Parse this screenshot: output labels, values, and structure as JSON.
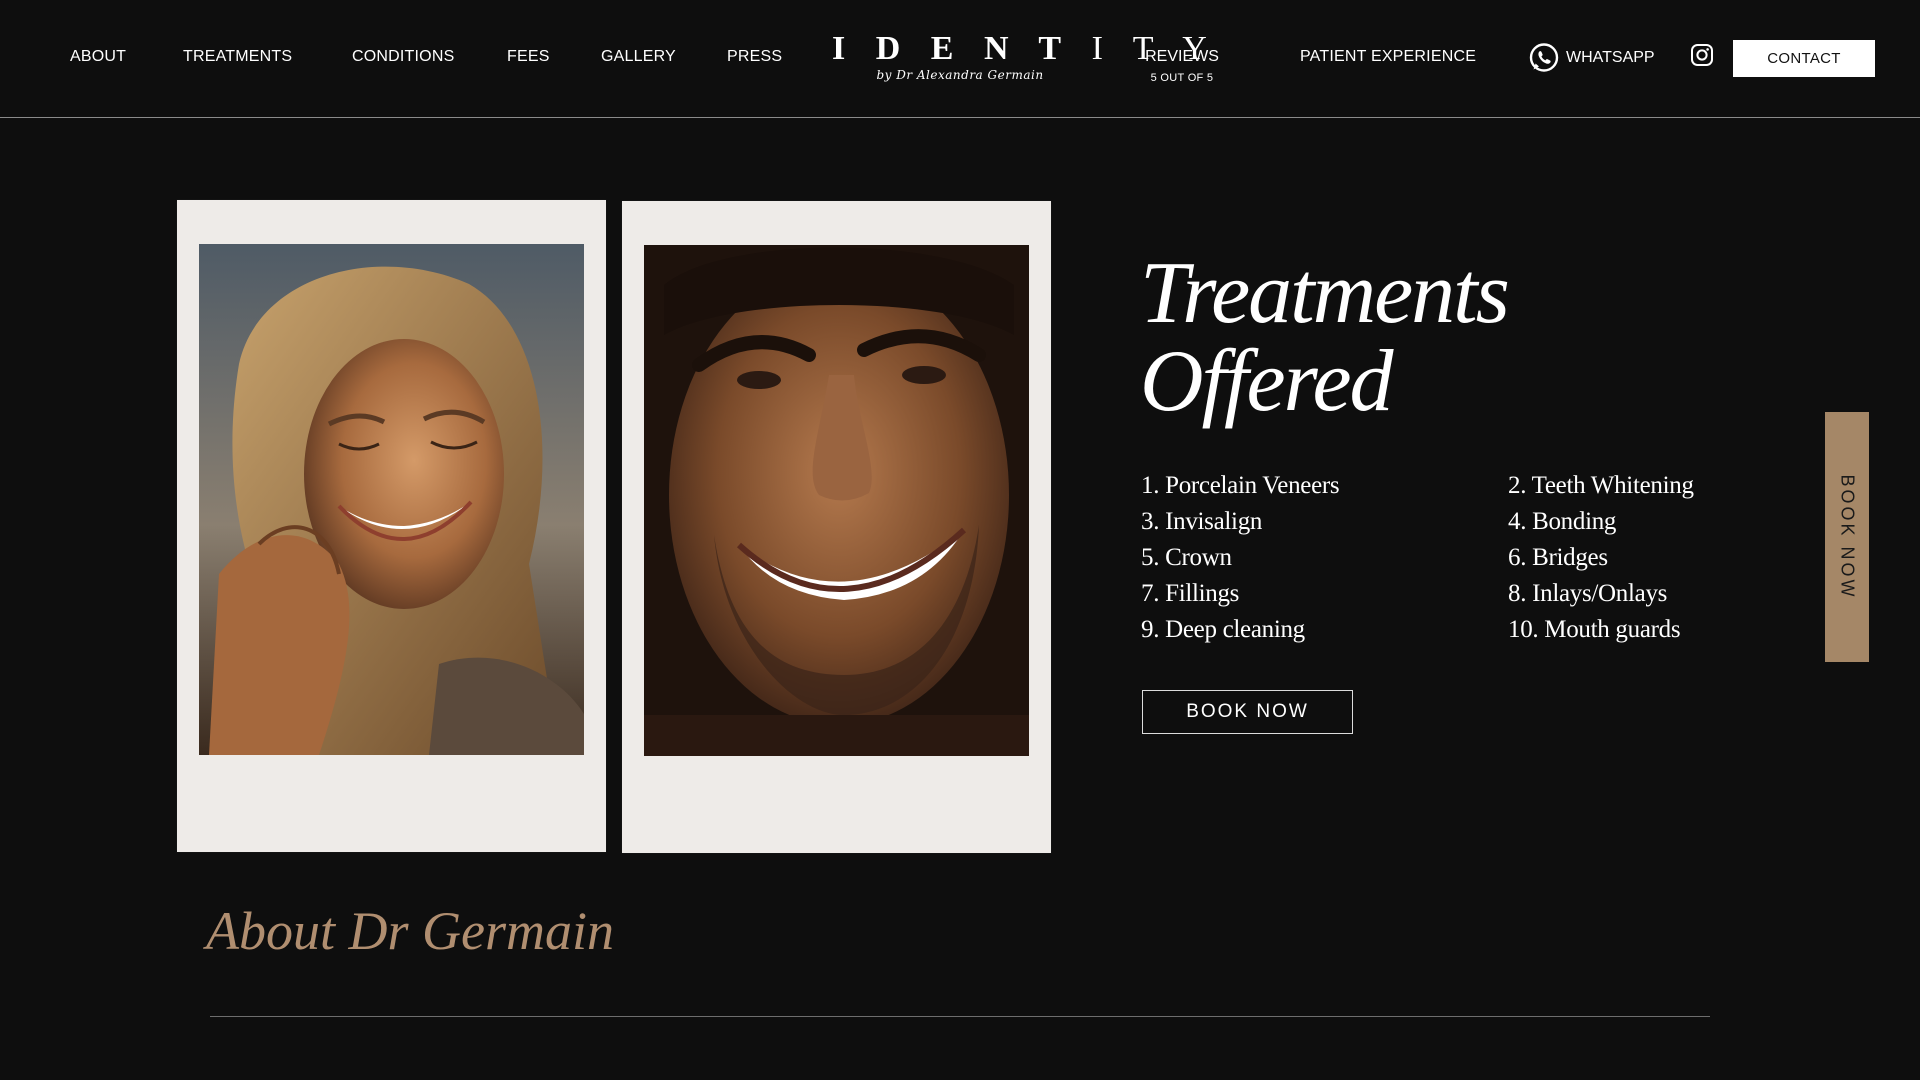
{
  "nav": {
    "about": "ABOUT",
    "treatments": "TREATMENTS",
    "conditions": "CONDITIONS",
    "fees": "FEES",
    "gallery": "GALLERY",
    "press": "PRESS",
    "reviews": "REVIEWS",
    "reviews_sub": "5 OUT OF 5",
    "patient_experience": "PATIENT EXPERIENCE",
    "whatsapp": "WHATSAPP",
    "contact": "CONTACT"
  },
  "logo": {
    "word_prefix": "I D E N T",
    "word_suffix": "I T Y",
    "subtitle": "by Dr Alexandra Germain"
  },
  "icons": {
    "whatsapp": "whatsapp-icon",
    "instagram": "instagram-icon"
  },
  "treatments": {
    "title_line1": "Treatments",
    "title_line2": "Offered",
    "items": [
      "1. Porcelain Veneers",
      "2. Teeth Whitening",
      "3. Invisalign",
      "4. Bonding",
      "5. Crown",
      "6. Bridges",
      "7. Fillings",
      "8. Inlays/Onlays",
      "9. Deep cleaning",
      "10. Mouth guards"
    ],
    "book_button": "BOOK NOW"
  },
  "side_tab": {
    "label": "BOOK NOW"
  },
  "about": {
    "title": "About Dr Germain"
  },
  "colors": {
    "background": "#0e0e0e",
    "accent_gold": "#b08e70",
    "side_tab": "#a58767",
    "polaroid_frame": "#eeebe8"
  }
}
